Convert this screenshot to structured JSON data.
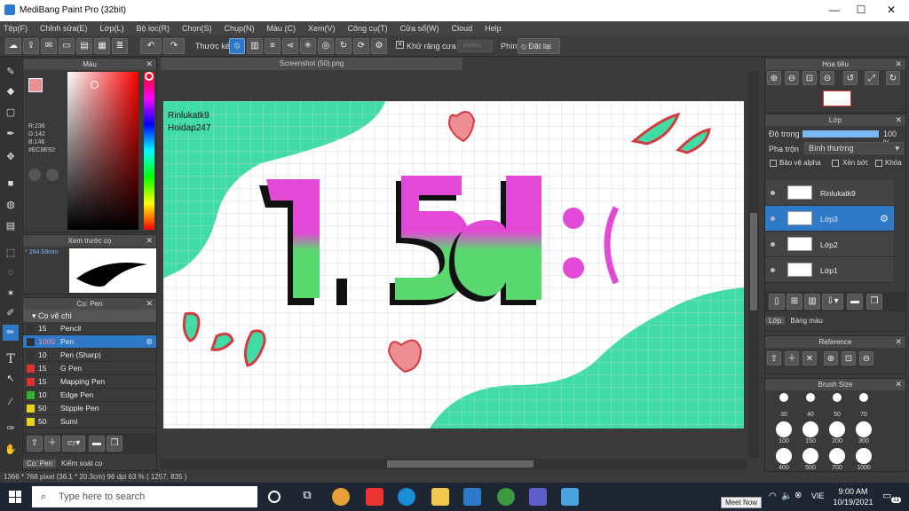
{
  "window": {
    "title": "MediBang Paint Pro (32bit)"
  },
  "menu": [
    "Tệp(F)",
    "Chỉnh sửa(E)",
    "Lớp(L)",
    "Bộ lọc(R)",
    "Chọn(S)",
    "Chụp(N)",
    "Màu (C)",
    "Xem(V)",
    "Công cụ(T)",
    "Cửa sổ(W)",
    "Cloud",
    "Help"
  ],
  "toolbar": {
    "stroke_label": "Thước kẻ",
    "antialias_label": "Khử răng cưa",
    "key_label": "Phím",
    "reset_label": "Đặt lại",
    "search_placeholder": "eselec"
  },
  "color_panel": {
    "title": "Màu",
    "r": "R:236",
    "g": "G:142",
    "b": "B:146",
    "hex": "#EC8E92",
    "fg_color": "#EC8E92"
  },
  "preview_panel": {
    "title": "Xem trước cọ",
    "size": "264.58mm"
  },
  "brush_panel": {
    "title": "Cọ: Pen",
    "group": "Cọ vẽ chì",
    "items": [
      {
        "size": "15",
        "name": "Pencil",
        "color": "#333333"
      },
      {
        "size": "1000",
        "name": "Pen",
        "color": "#333333"
      },
      {
        "size": "10",
        "name": "Pen (Sharp)",
        "color": "#333333"
      },
      {
        "size": "15",
        "name": "G Pen",
        "color": "#e03030"
      },
      {
        "size": "15",
        "name": "Mapping Pen",
        "color": "#e03030"
      },
      {
        "size": "10",
        "name": "Edge Pen",
        "color": "#2ab52a"
      },
      {
        "size": "50",
        "name": "Stipple Pen",
        "color": "#e6d21f"
      },
      {
        "size": "50",
        "name": "Sumi",
        "color": "#e6d21f"
      }
    ],
    "tab1": "Cọ: Pen",
    "tab2": "Kiểm soát cọ"
  },
  "document": {
    "tab": "Screenshot (50).png",
    "text1": "Rinlukatk9",
    "text2": "Hoidap247",
    "art": "1,5đ :("
  },
  "navigator": {
    "title": "Hoa tiêu"
  },
  "layer_panel": {
    "title": "Lớp",
    "opacity_label": "Độ trong",
    "opacity": "100 %",
    "opacity_value": 1.0,
    "blend_label": "Pha trộn",
    "blend": "Bình thường",
    "protect_alpha": "Bảo vệ alpha",
    "clip": "Xén bớt",
    "lock": "Khóa",
    "layers": [
      {
        "name": "Rinlukatk9"
      },
      {
        "name": "Lớp3"
      },
      {
        "name": "Lớp2"
      },
      {
        "name": "Lớp1"
      }
    ],
    "tab1": "Lớp",
    "tab2": "Bảng màu"
  },
  "reference": {
    "title": "Reference"
  },
  "brush_size": {
    "title": "Brush Size",
    "row1": [
      "30",
      "40",
      "50",
      "70"
    ],
    "row2": [
      "100",
      "150",
      "200",
      "300"
    ],
    "row3": [
      "400",
      "500",
      "700",
      "1000"
    ]
  },
  "status": {
    "text": "1366 * 768 pixel   (36.1 * 20.3cm)   96 dpi   63 %   ( 1257, 835 )"
  },
  "taskbar": {
    "search_placeholder": "Type here to search",
    "time": "9:00 AM",
    "date": "10/19/2021",
    "lang": "VIE",
    "tooltip": "Meet Now",
    "badge": "11"
  }
}
